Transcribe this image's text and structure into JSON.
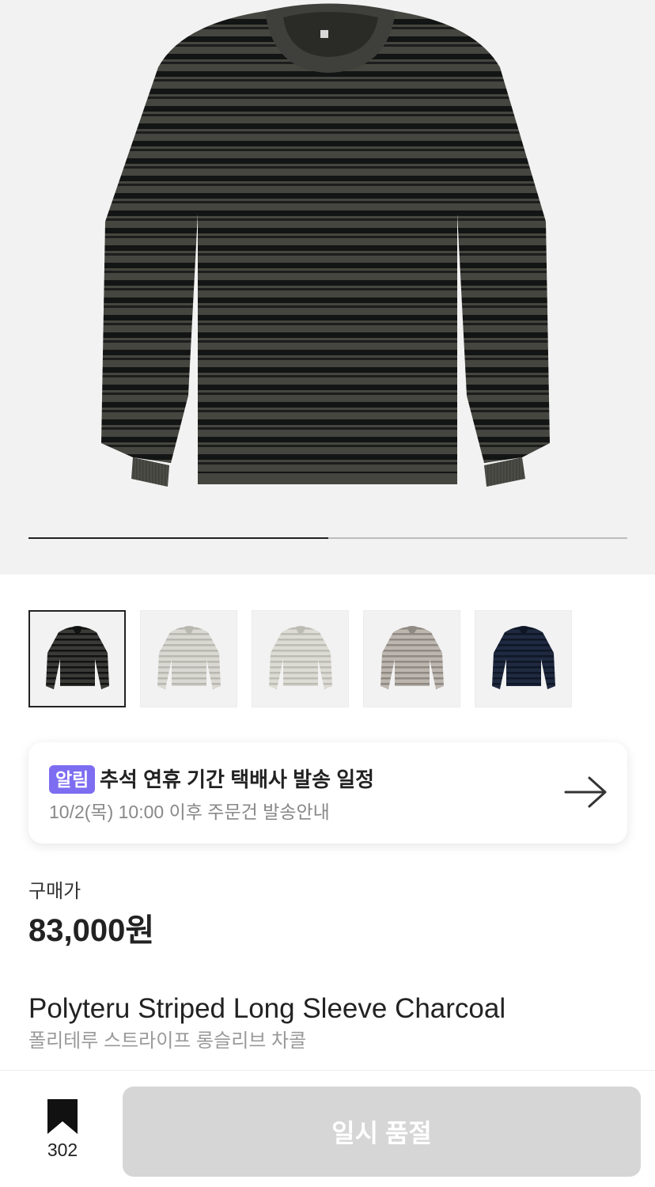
{
  "gallery": {
    "main_image": "charcoal-striped-long-sleeve-shirt",
    "progress_fraction": 0.5,
    "thumbnails": [
      {
        "color_name": "charcoal",
        "body": "#3a3b37",
        "stripe": "#111212",
        "selected": true
      },
      {
        "color_name": "light-gray",
        "body": "#d9d8d2",
        "stripe": "#b8b7b0",
        "selected": false
      },
      {
        "color_name": "ivory",
        "body": "#dcdbd4",
        "stripe": "#bdbcb4",
        "selected": false
      },
      {
        "color_name": "taupe",
        "body": "#bcb6af",
        "stripe": "#8f8983",
        "selected": false
      },
      {
        "color_name": "navy",
        "body": "#1f2a40",
        "stripe": "#0f1626",
        "selected": false
      }
    ]
  },
  "notice": {
    "badge": "알림",
    "title": "추석 연휴 기간 택배사 발송 일정",
    "subtitle": "10/2(목) 10:00 이후 주문건 발송안내",
    "arrow_icon": "arrow-right-icon"
  },
  "price": {
    "label": "구매가",
    "value": "83,000원"
  },
  "product": {
    "name_en": "Polyteru Striped Long Sleeve Charcoal",
    "name_ko": "폴리테루 스트라이프 롱슬리브 차콜"
  },
  "bottom_bar": {
    "bookmark_icon": "bookmark-icon",
    "bookmark_count": "302",
    "action_label": "일시 품절"
  },
  "colors": {
    "badge": "#7c6df1",
    "disabled_button": "#d6d6d6"
  }
}
